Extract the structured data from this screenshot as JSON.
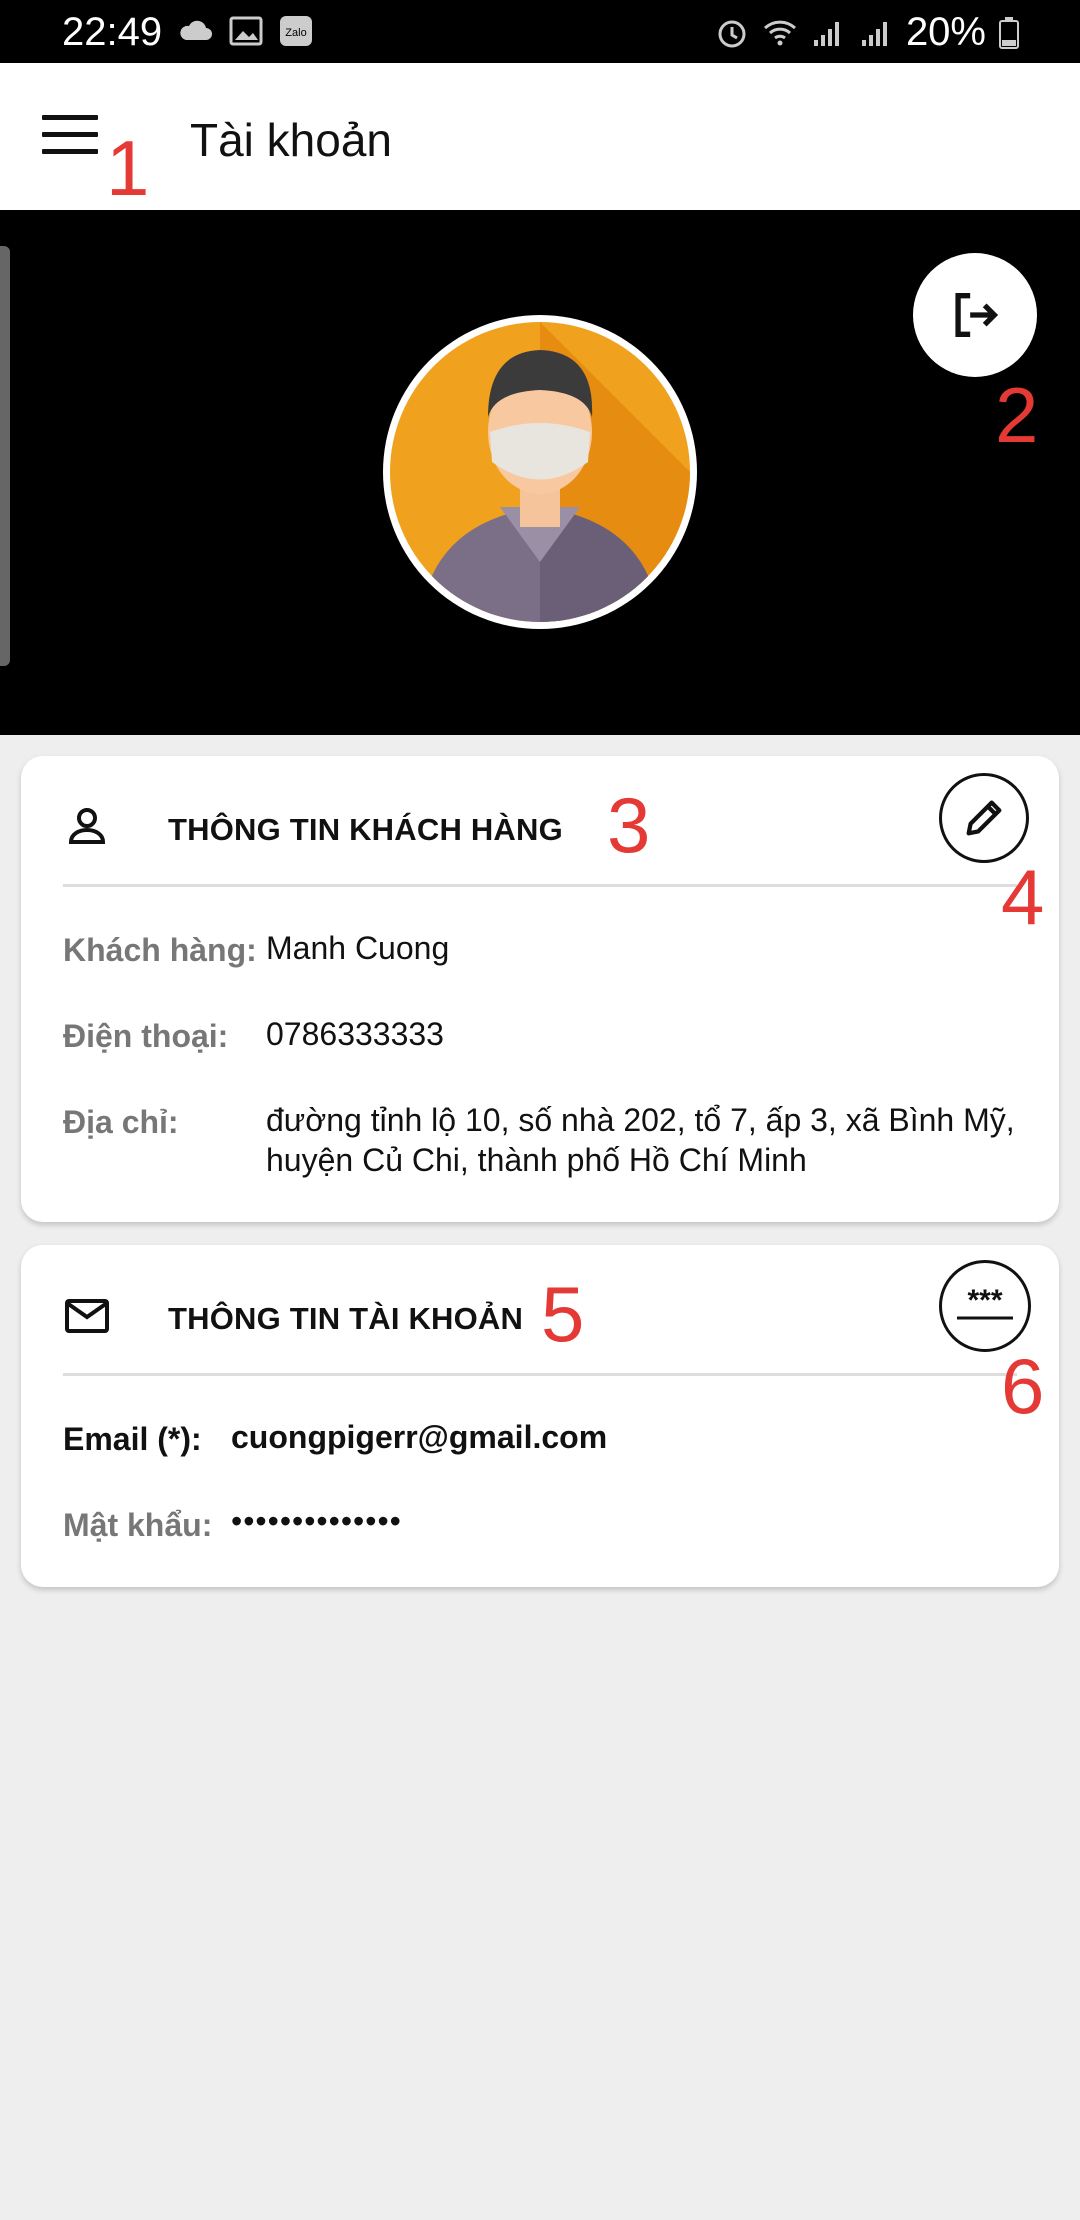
{
  "status_bar": {
    "time": "22:49",
    "left_icons": [
      "cloud-icon",
      "image-icon",
      "zalo-icon"
    ],
    "zalo_text": "Zalo",
    "right_icons": [
      "alarm-icon",
      "wifi-icon",
      "signal-icon",
      "signal-icon"
    ],
    "battery_percent": "20%"
  },
  "app_bar": {
    "title": "Tài khoản",
    "menu_icon": "hamburger-menu-icon"
  },
  "annotations": [
    "1",
    "2",
    "3",
    "4",
    "5",
    "6"
  ],
  "header": {
    "logout_icon": "logout-icon",
    "avatar_icon": "user-avatar-masked"
  },
  "customer_card": {
    "title": "THÔNG TIN KHÁCH HÀNG",
    "icon": "person-icon",
    "edit_icon": "pencil-edit-icon",
    "fields": [
      {
        "label": "Khách hàng:",
        "value": "Manh Cuong"
      },
      {
        "label": "Điện thoại:",
        "value": "0786333333"
      },
      {
        "label": "Địa chỉ:",
        "value_line1": "đường tỉnh lộ 10, số nhà 202, tổ 7, ấp 3, xã Bình Mỹ,",
        "value_line2": "huyện Củ Chi, thành phố Hồ Chí Minh"
      }
    ]
  },
  "account_card": {
    "title": "THÔNG TIN TÀI KHOẢN",
    "icon": "mail-icon",
    "password_icon": "change-password-icon",
    "fields": [
      {
        "label": "Email (*):",
        "value": "cuongpigerr@gmail.com"
      },
      {
        "label": "Mật khẩu:",
        "value": "••••••••••••••"
      }
    ]
  },
  "colors": {
    "accent_annotation": "#e53935",
    "header_bg": "#000000",
    "page_bg": "#eeeeef"
  }
}
